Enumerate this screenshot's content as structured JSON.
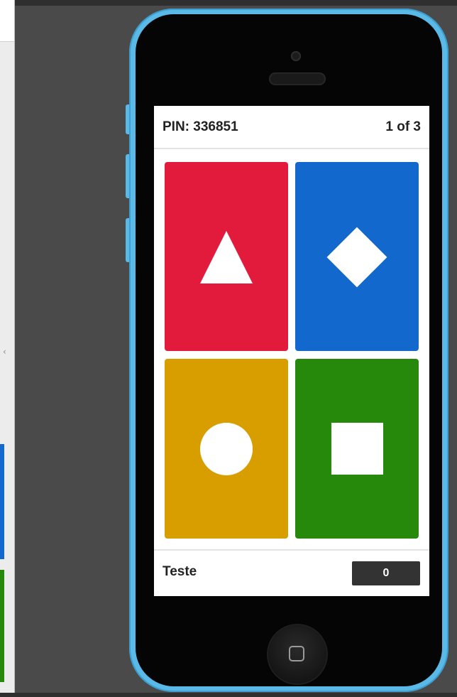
{
  "game": {
    "pin": "PIN: 336851",
    "question_counter": "1 of 3",
    "nickname": "Teste",
    "score": "0"
  },
  "answers": [
    {
      "shape": "triangle-icon",
      "color": "#e21b3c"
    },
    {
      "shape": "diamond-icon",
      "color": "#1368ce"
    },
    {
      "shape": "circle-icon",
      "color": "#d89e00"
    },
    {
      "shape": "square-icon",
      "color": "#26890c"
    }
  ],
  "colors": {
    "phone_body": "#5ab9e6",
    "background": "#4a4a4a"
  }
}
